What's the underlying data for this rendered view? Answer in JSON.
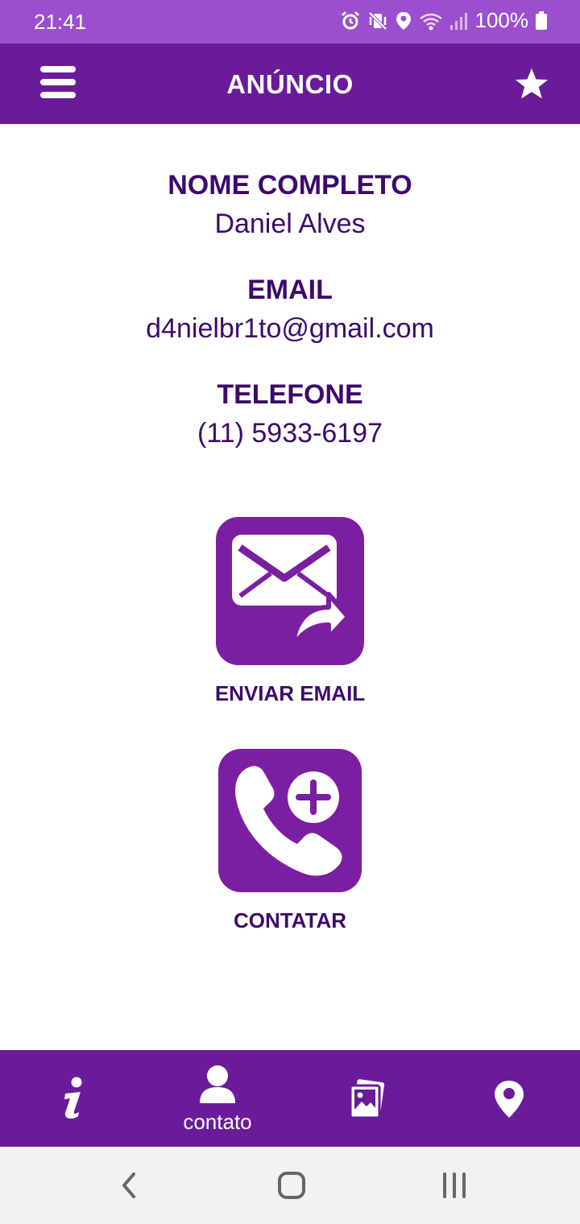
{
  "status_bar": {
    "time": "21:41",
    "battery": "100%"
  },
  "app_bar": {
    "title": "ANÚNCIO"
  },
  "fields": [
    {
      "label": "NOME COMPLETO",
      "value": "Daniel Alves"
    },
    {
      "label": "EMAIL",
      "value": "d4nielbr1to@gmail.com"
    },
    {
      "label": "TELEFONE",
      "value": "(11) 5933-6197"
    }
  ],
  "actions": {
    "email": {
      "label": "ENVIAR EMAIL",
      "icon": "email-send-icon"
    },
    "contact": {
      "label": "CONTATAR",
      "icon": "phone-add-icon"
    }
  },
  "bottom_nav": {
    "active": "contato",
    "items": [
      {
        "icon": "info-icon"
      },
      {
        "icon": "person-icon",
        "label": "contato"
      },
      {
        "icon": "photos-icon"
      },
      {
        "icon": "location-pin-icon"
      }
    ]
  },
  "colors": {
    "primary": "#6a1b9a",
    "status_bar": "#9b4fcf",
    "text": "#3d0a6b",
    "tile": "#7b1fa2"
  }
}
